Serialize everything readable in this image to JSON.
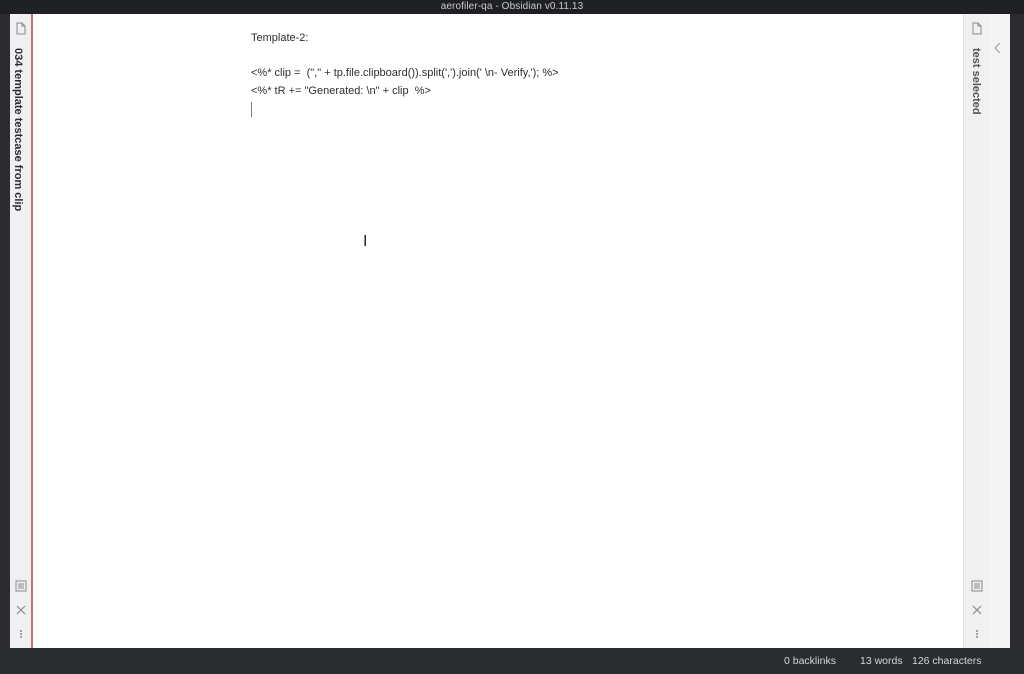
{
  "window": {
    "title": "aerofiler-qa - Obsidian v0.11.13"
  },
  "left_pane": {
    "title": "034 template testcase from clip"
  },
  "editor": {
    "lines": [
      "Template-2:",
      "",
      "<%* clip =  (\",\" + tp.file.clipboard()).split(',').join(' \\n- Verify,'); %>",
      "<%* tR += \"Generated: \\n\" + clip  %>"
    ]
  },
  "right_pane": {
    "title": "test selected"
  },
  "status_bar": {
    "backlinks": "0 backlinks",
    "words": "13 words",
    "characters": "126 characters"
  },
  "icons": {
    "file": "file-icon",
    "reading": "reading-view-icon",
    "close": "close-icon",
    "more": "more-options-icon",
    "chevron": "chevron-left-icon"
  }
}
